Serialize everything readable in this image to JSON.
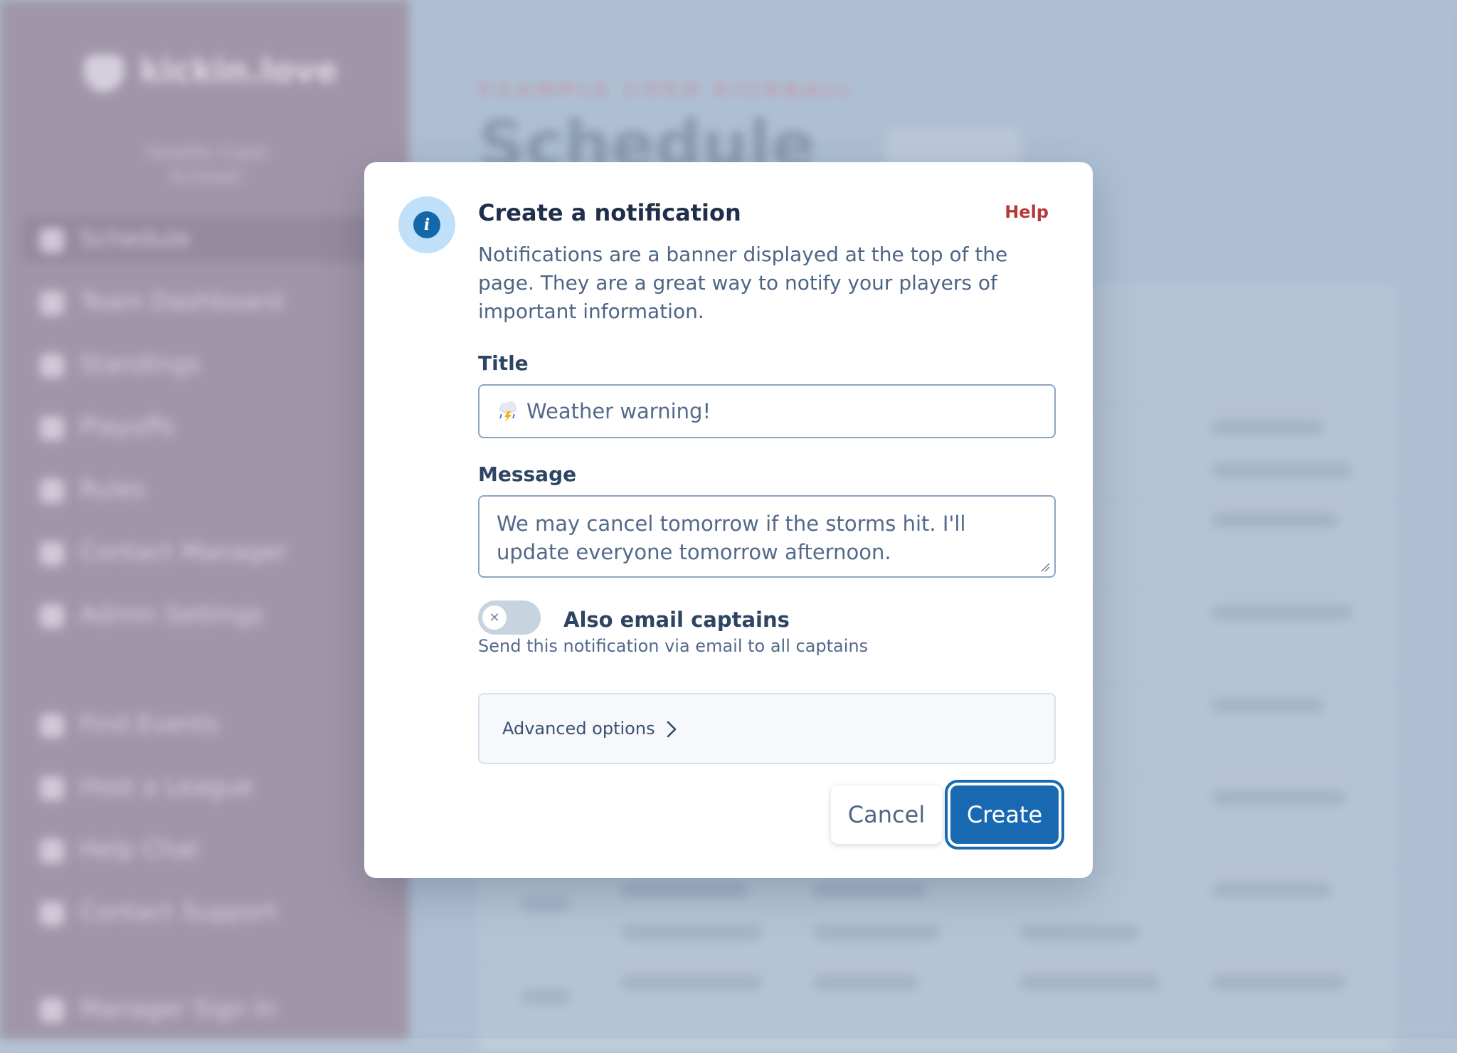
{
  "background": {
    "logo": "kickin.love",
    "league_name": "Seattle Coed Kickball",
    "nav": [
      {
        "label": "Schedule",
        "icon": "calendar-icon",
        "active": true
      },
      {
        "label": "Team Dashboard",
        "icon": "dashboard-icon",
        "active": false
      },
      {
        "label": "Standings",
        "icon": "list-icon",
        "active": false
      },
      {
        "label": "Playoffs",
        "icon": "trophy-icon",
        "active": false
      },
      {
        "label": "Rules",
        "icon": "book-icon",
        "active": false
      },
      {
        "label": "Contact Manager",
        "icon": "mail-icon",
        "active": false
      },
      {
        "label": "Admin Settings",
        "icon": "shield-icon",
        "active": false
      }
    ],
    "nav_lower": [
      {
        "label": "Find Events",
        "icon": "search-icon"
      },
      {
        "label": "Host a League",
        "icon": "plus-icon"
      },
      {
        "label": "Help Chat",
        "icon": "chat-icon"
      },
      {
        "label": "Contact Support",
        "icon": "support-icon"
      }
    ],
    "footer_nav": {
      "label": "Manager Sign In",
      "icon": "user-icon"
    },
    "breadcrumb": "EXAMPLE COED KICKBALL",
    "page_title": "Schedule"
  },
  "modal": {
    "title": "Create a notification",
    "help_label": "Help",
    "description": "Notifications are a banner displayed at the top of the page. They are a great way to notify your players of important information.",
    "title_field": {
      "label": "Title",
      "value": "Weather warning!",
      "icon": "storm-cloud-icon"
    },
    "message_field": {
      "label": "Message",
      "value": "We may cancel tomorrow if the storms hit. I'll update everyone tomorrow afternoon."
    },
    "toggle": {
      "label": "Also email captains",
      "help": "Send this notification via email to all captains",
      "on": false
    },
    "advanced_label": "Advanced options",
    "cancel_label": "Cancel",
    "create_label": "Create"
  },
  "colors": {
    "primary": "#1869b1",
    "help_red": "#b43a3a",
    "info_badge": "#bfe0f8",
    "sidebar_bg": "#a698a9"
  }
}
